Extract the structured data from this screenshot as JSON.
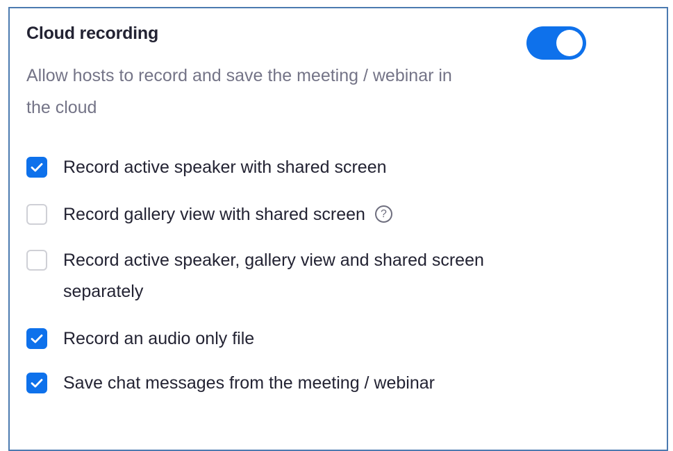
{
  "setting": {
    "title": "Cloud recording",
    "description": "Allow hosts to record and save the meeting / webinar in the cloud",
    "toggle_on": true
  },
  "options": [
    {
      "label": "Record active speaker with shared screen",
      "checked": true
    },
    {
      "label": "Record gallery view with shared screen",
      "checked": false,
      "help_icon": "question-circle-icon",
      "help_glyph": "?"
    },
    {
      "label": "Record active speaker, gallery view and shared screen separately",
      "checked": false
    },
    {
      "label": "Record an audio only file",
      "checked": true
    },
    {
      "label": "Save chat messages from the meeting / webinar",
      "checked": true
    }
  ],
  "colors": {
    "accent": "#0e71eb",
    "frame_border": "#4b7ab0",
    "title_text": "#232333",
    "description_text": "#747487",
    "checkbox_border": "#cfd0d6"
  }
}
